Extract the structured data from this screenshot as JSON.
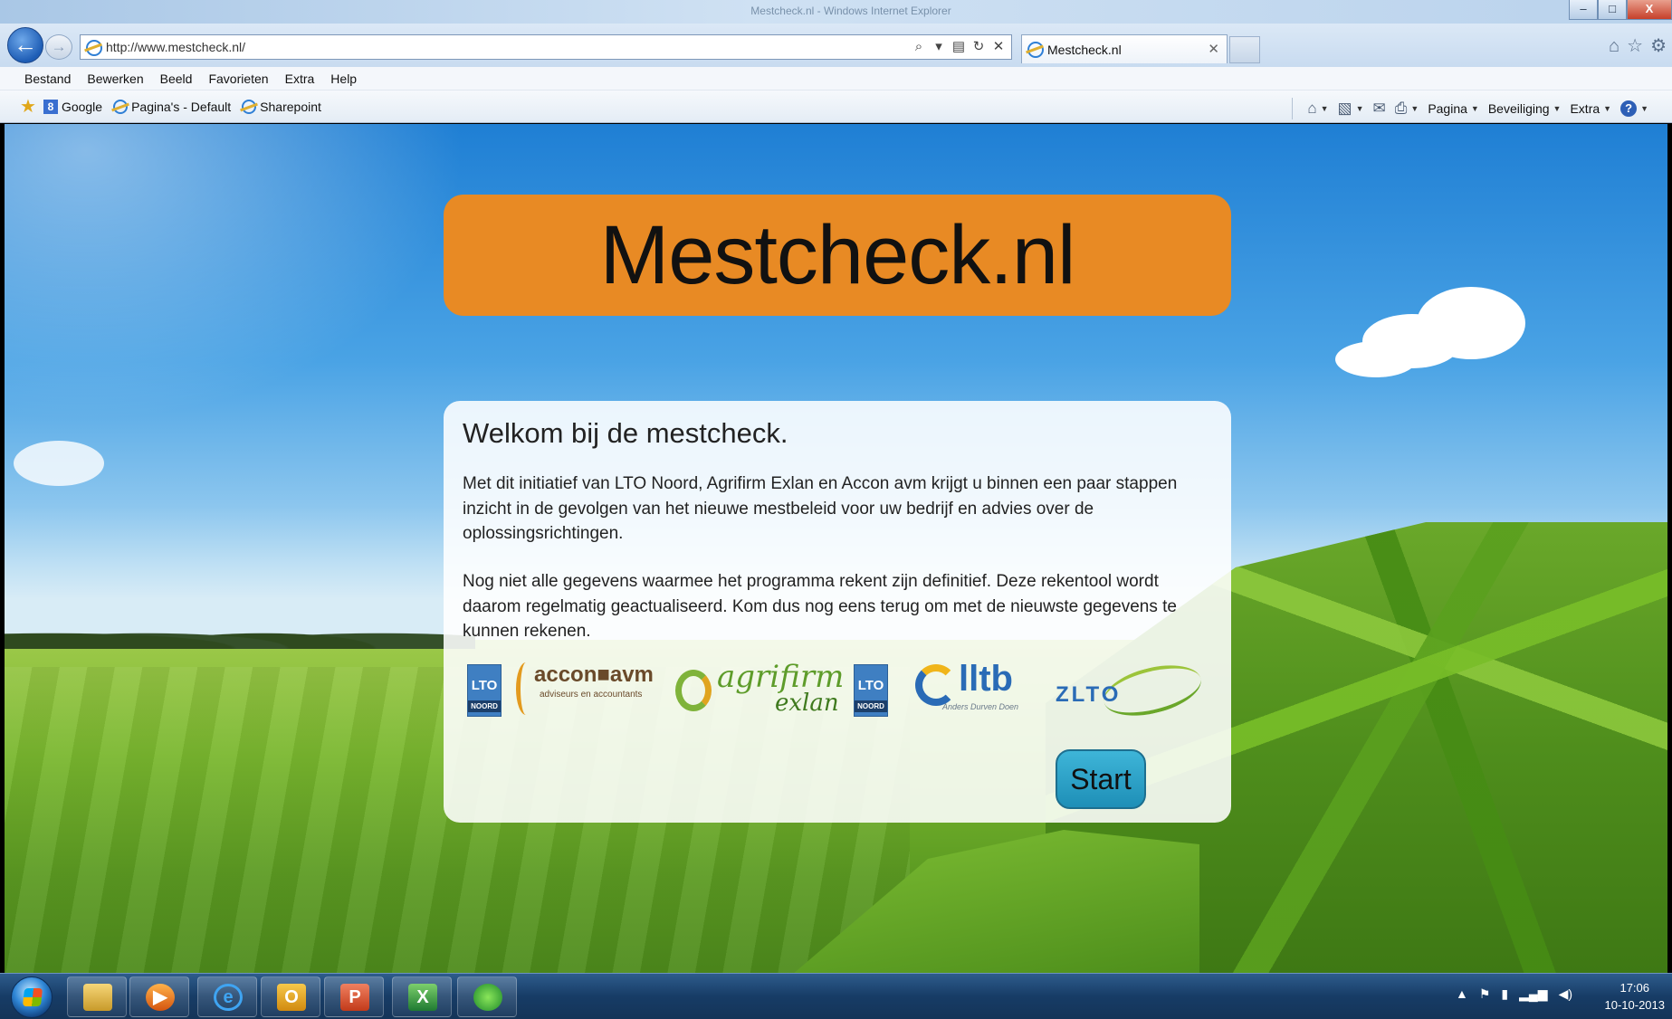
{
  "browser": {
    "window_title": "Mestcheck.nl - Windows Internet Explorer",
    "window_buttons": {
      "minimize": "–",
      "maximize": "□",
      "close": "X"
    },
    "address": {
      "url": "http://www.mestcheck.nl/"
    },
    "address_tools": [
      "⌕",
      "▾",
      "▤",
      "↻",
      "✕"
    ],
    "tab": {
      "label": "Mestcheck.nl",
      "close": "✕"
    },
    "nav_right_icons": [
      "home-icon",
      "star-icon",
      "gear-icon"
    ],
    "menu": [
      "Bestand",
      "Bewerken",
      "Beeld",
      "Favorieten",
      "Extra",
      "Help"
    ],
    "favorites": [
      {
        "label": "Google",
        "icon": "google-icon"
      },
      {
        "label": "Pagina's - Default",
        "icon": "ie-page-icon"
      },
      {
        "label": "Sharepoint",
        "icon": "ie-page-icon"
      }
    ],
    "commandbar": {
      "page": "Pagina",
      "safety": "Beveiliging",
      "tools": "Extra",
      "help": "?"
    }
  },
  "page": {
    "site_title": "Mestcheck.nl",
    "welcome_title": "Welkom bij de mestcheck.",
    "paragraph1": "Met dit initiatief van LTO Noord, Agrifirm Exlan en Accon avm krijgt u binnen een paar stappen inzicht in de gevolgen van het nieuwe mestbeleid voor uw bedrijf en advies over de oplossingsrichtingen.",
    "paragraph2": "Nog niet alle gegevens waarmee het programma rekent zijn definitief. Deze rekentool wordt daarom regelmatig geactualiseerd. Kom dus nog eens terug om met de nieuwste gegevens te kunnen rekenen.",
    "logos": {
      "lto_noord": {
        "main": "LTO",
        "sub": "NOORD"
      },
      "accon": {
        "name": "accon■avm",
        "sub": "adviseurs en accountants"
      },
      "agrifirm": {
        "name": "agrifirm",
        "sub": "exlan"
      },
      "lto_fondsen": {
        "main": "LTO",
        "sub": "NOORD"
      },
      "lltb": {
        "name": "lltb",
        "tag": "Anders Durven Doen"
      },
      "zlto": {
        "name": "ZLTO"
      }
    },
    "start_button": "Start"
  },
  "taskbar": {
    "items": [
      "windows-explorer",
      "media-player",
      "internet-explorer",
      "outlook",
      "powerpoint",
      "excel",
      "green-app"
    ],
    "clock_time": "17:06",
    "clock_date": "10-10-2013"
  },
  "colors": {
    "banner": "#e88a24",
    "start_button": "#2a9fc7",
    "panel": "rgba(255,255,255,0.88)"
  }
}
